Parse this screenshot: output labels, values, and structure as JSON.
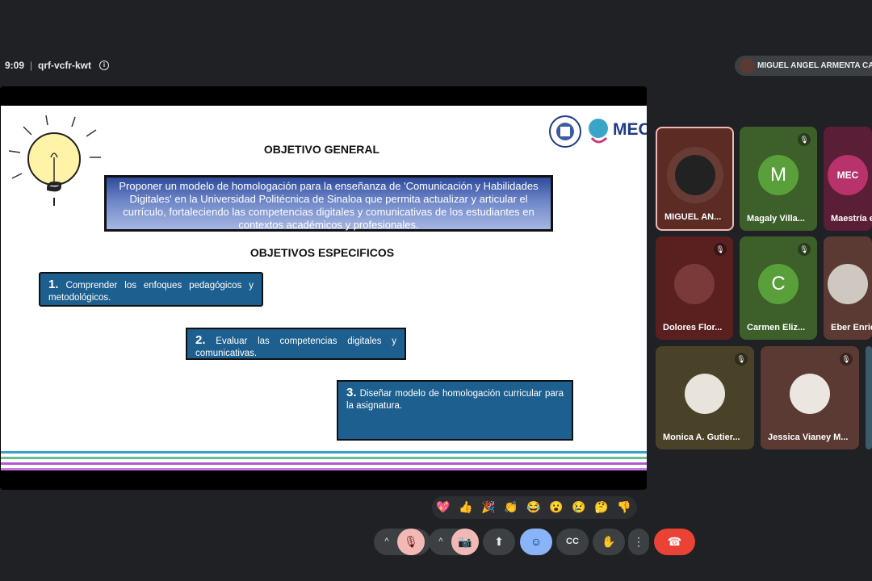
{
  "meeting": {
    "time": "9:09",
    "separator": "|",
    "code": "qrf-vcfr-kwt",
    "info_icon": "i",
    "presenter_name": "MIGUEL ANGEL ARMENTA CAR"
  },
  "slide": {
    "title_general": "OBJETIVO GENERAL",
    "general_text": "Proponer un modelo de homologación para la enseñanza de 'Comunicación y Habilidades Digitales' en la Universidad Politécnica de Sinaloa que permita actualizar y articular el currículo, fortaleciendo las competencias digitales y comunicativas de los estudiantes en contextos académicos y profesionales.",
    "title_especificos": "OBJETIVOS ESPECIFICOS",
    "objectives": [
      {
        "number": "1.",
        "text": "Comprender los enfoques pedagógicos y metodológicos."
      },
      {
        "number": "2.",
        "text": "Evaluar las competencias digitales y comunicativas."
      },
      {
        "number": "3.",
        "text": "Diseñar modelo de homologación curricular para la asignatura."
      }
    ],
    "logo_text": "MEC",
    "stripe_colors": [
      "#3aa0c8",
      "#6bbf8f",
      "#b05ad0",
      "#c87ae0"
    ]
  },
  "participants": [
    {
      "name": "MIGUEL AN...",
      "initial": "",
      "bg": "#5c2b24",
      "avatar": "#222",
      "muted": false
    },
    {
      "name": "Magaly Villa...",
      "initial": "M",
      "bg": "#3d5f2a",
      "avatar": "#5aa03a",
      "muted": true
    },
    {
      "name": "Maestría e",
      "initial": "MEC",
      "bg": "#5a1f36",
      "avatar": "#b8326b",
      "muted": false
    },
    {
      "name": "Dolores Flor...",
      "initial": "",
      "bg": "#5a2020",
      "avatar": "#7a3a3a",
      "muted": true
    },
    {
      "name": "Carmen Eliz...",
      "initial": "C",
      "bg": "#3d5f2a",
      "avatar": "#5aa03a",
      "muted": true
    },
    {
      "name": "Eber Enric",
      "initial": "",
      "bg": "#5a3a32",
      "avatar": "#cfc8c0",
      "muted": false
    },
    {
      "name": "Monica A. Gutier...",
      "initial": "",
      "bg": "#4a4228",
      "avatar": "#e8e4dc",
      "muted": true
    },
    {
      "name": "Jessica Vianey M...",
      "initial": "",
      "bg": "#5a3a32",
      "avatar": "#ece6e0",
      "muted": true
    }
  ],
  "reactions": [
    "💖",
    "👍",
    "🎉",
    "👏",
    "😂",
    "😮",
    "😢",
    "🤔",
    "👎"
  ],
  "controls": {
    "chevron": "^",
    "mic": "🎙",
    "camera": "📷",
    "present": "⬆",
    "emoji": "☺",
    "captions": "CC",
    "hand": "✋",
    "more": "⋮",
    "end": "☎"
  }
}
